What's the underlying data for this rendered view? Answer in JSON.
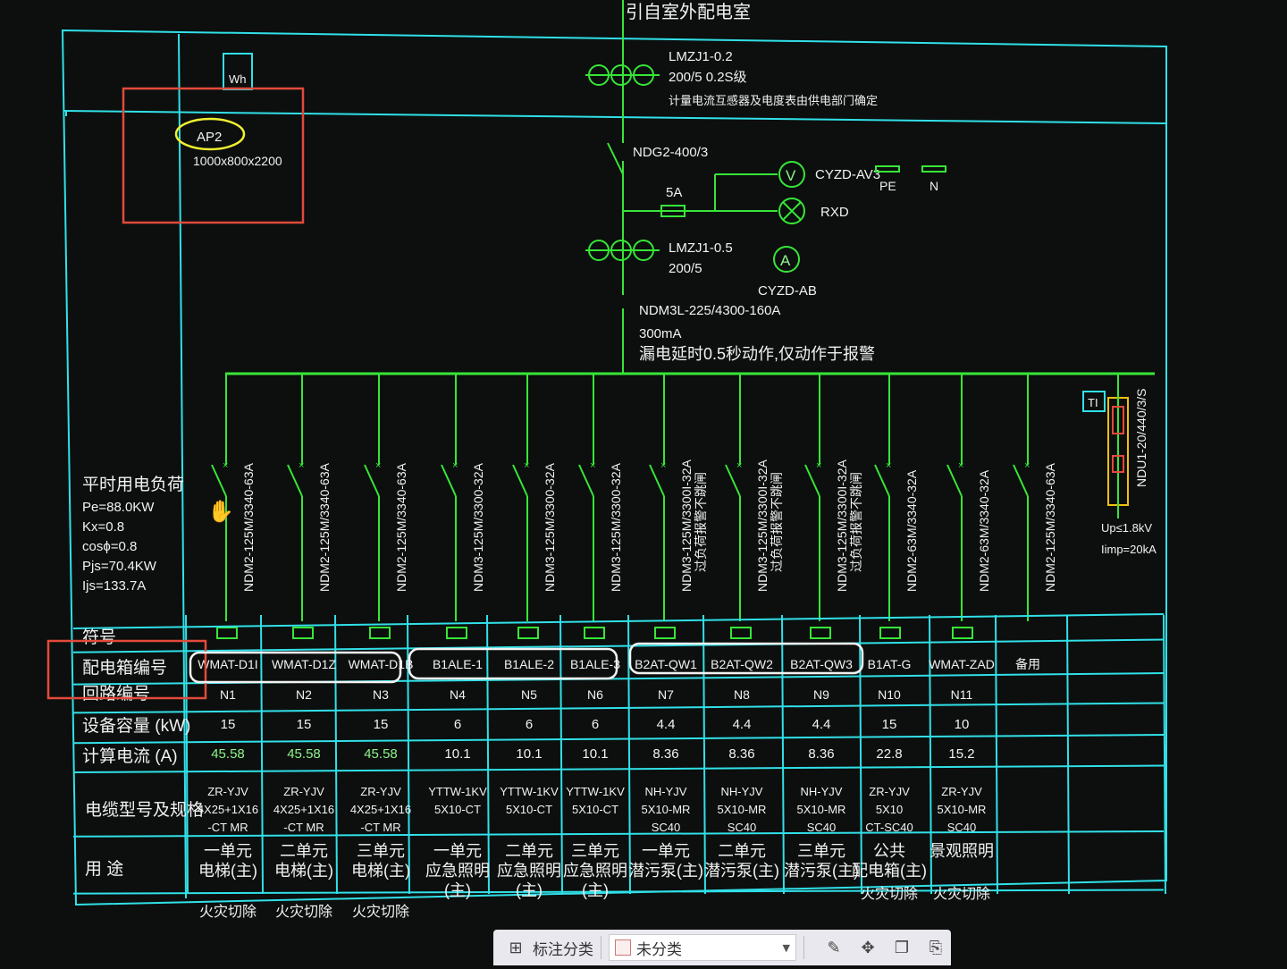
{
  "header": {
    "source": "引自室外配电室",
    "meter_label": "Wh",
    "cabinet_id": "AP2",
    "cabinet_size": "1000x800x2200"
  },
  "main_circuit": {
    "ct_top_model": "LMZJ1-0.2",
    "ct_top_rating": "200/5   0.2S级",
    "ct_top_note": "计量电流互感器及电度表由供电部门确定",
    "switch_model": "NDG2-400/3",
    "fuse_rating": "5A",
    "voltmeter": "V",
    "voltmeter_model": "CYZD-AV3",
    "lamp_model": "RXD",
    "pe_label": "PE",
    "n_label": "N",
    "ct_bottom_model": "LMZJ1-0.5",
    "ct_bottom_rating": "200/5",
    "ammeter": "A",
    "ammeter_model": "CYZD-AB",
    "breaker_model": "NDM3L-225/4300-160A",
    "leak_current": "300mA",
    "leak_note": "漏电延时0.5秒动作,仅动作于报警",
    "spd_model": "NDU1-20/440/3/S",
    "spd_label": "TI",
    "spd_up": "Up≤1.8kV",
    "spd_imp": "Iimp=20kA"
  },
  "load_summary": {
    "title": "平时用电负荷",
    "pe": "Pe=88.0KW",
    "kx": "Kx=0.8",
    "cos": "cosϕ=0.8",
    "pjs": "Pjs=70.4KW",
    "ijs": "Ijs=133.7A"
  },
  "row_labels": {
    "symbol": "符号",
    "box_no": "配电箱编号",
    "circuit_no": "回路编号",
    "capacity": "设备容量 (kW)",
    "current": "计算电流 (A)",
    "cable": "电缆型号及规格",
    "use": "用    途"
  },
  "branches": [
    {
      "breaker": "NDM2-125M/3340-63A",
      "box": "WMAT-D1I",
      "circuit": "N1",
      "kw": "15",
      "amp": "45.58",
      "cable": [
        "ZR-YJV",
        "4X25+1X16",
        "-CT MR"
      ],
      "use": [
        "一单元",
        "电梯(主)"
      ],
      "note": "火灾切除"
    },
    {
      "breaker": "NDM2-125M/3340-63A",
      "box": "WMAT-D1Z",
      "circuit": "N2",
      "kw": "15",
      "amp": "45.58",
      "cable": [
        "ZR-YJV",
        "4X25+1X16",
        "-CT MR"
      ],
      "use": [
        "二单元",
        "电梯(主)"
      ],
      "note": "火灾切除"
    },
    {
      "breaker": "NDM2-125M/3340-63A",
      "box": "WMAT-D1B",
      "circuit": "N3",
      "kw": "15",
      "amp": "45.58",
      "cable": [
        "ZR-YJV",
        "4X25+1X16",
        "-CT MR"
      ],
      "use": [
        "三单元",
        "电梯(主)"
      ],
      "note": "火灾切除"
    },
    {
      "breaker": "NDM3-125M/3300-32A",
      "box": "B1ALE-1",
      "circuit": "N4",
      "kw": "6",
      "amp": "10.1",
      "cable": [
        "YTTW-1KV",
        "5X10-CT"
      ],
      "use": [
        "一单元",
        "应急照明",
        "(主)"
      ],
      "note": ""
    },
    {
      "breaker": "NDM3-125M/3300-32A",
      "box": "B1ALE-2",
      "circuit": "N5",
      "kw": "6",
      "amp": "10.1",
      "cable": [
        "YTTW-1KV",
        "5X10-CT"
      ],
      "use": [
        "二单元",
        "应急照明",
        "(主)"
      ],
      "note": ""
    },
    {
      "breaker": "NDM3-125M/3300-32A",
      "box": "B1ALE-3",
      "circuit": "N6",
      "kw": "6",
      "amp": "10.1",
      "cable": [
        "YTTW-1KV",
        "5X10-CT"
      ],
      "use": [
        "三单元",
        "应急照明",
        "(主)"
      ],
      "note": ""
    },
    {
      "breaker": "NDM3-125M/3300I-32A",
      "breaker2": "过负荷报警不跳闸",
      "box": "B2AT-QW1",
      "circuit": "N7",
      "kw": "4.4",
      "amp": "8.36",
      "cable": [
        "NH-YJV",
        "5X10-MR",
        "SC40"
      ],
      "use": [
        "一单元",
        "潜污泵(主)"
      ],
      "note": ""
    },
    {
      "breaker": "NDM3-125M/3300I-32A",
      "breaker2": "过负荷报警不跳闸",
      "box": "B2AT-QW2",
      "circuit": "N8",
      "kw": "4.4",
      "amp": "8.36",
      "cable": [
        "NH-YJV",
        "5X10-MR",
        "SC40"
      ],
      "use": [
        "二单元",
        "潜污泵(主)"
      ],
      "note": ""
    },
    {
      "breaker": "NDM3-125M/3300I-32A",
      "breaker2": "过负荷报警不跳闸",
      "box": "B2AT-QW3",
      "circuit": "N9",
      "kw": "4.4",
      "amp": "8.36",
      "cable": [
        "NH-YJV",
        "5X10-MR",
        "SC40"
      ],
      "use": [
        "三单元",
        "潜污泵(主)"
      ],
      "note": ""
    },
    {
      "breaker": "NDM2-63M/3340-32A",
      "box": "B1AT-G",
      "circuit": "N10",
      "kw": "15",
      "amp": "22.8",
      "cable": [
        "ZR-YJV",
        "5X10",
        "CT-SC40"
      ],
      "use": [
        "公共",
        "配电箱(主)"
      ],
      "note": "火灾切除"
    },
    {
      "breaker": "NDM2-63M/3340-32A",
      "box": "WMAT-ZAD",
      "circuit": "N11",
      "kw": "10",
      "amp": "15.2",
      "cable": [
        "ZR-YJV",
        "5X10-MR",
        "SC40"
      ],
      "use": [
        "景观照明"
      ],
      "note": "火灾切除"
    },
    {
      "breaker": "NDM2-125M/3340-63A",
      "box": "备用",
      "circuit": "",
      "kw": "",
      "amp": "",
      "cable": [],
      "use": [],
      "note": ""
    }
  ],
  "toolbar": {
    "grid_icon": "grid-icon",
    "label": "标注分类",
    "select_value": "未分类",
    "icons": [
      "edit-icon",
      "move-icon",
      "copy-icon",
      "paste-icon"
    ]
  },
  "colors": {
    "frame": "#31e0e8",
    "line": "#37e637",
    "text": "#f2f2f2",
    "highlight_red": "#e24a3b",
    "highlight_yellow": "#f0f030"
  }
}
